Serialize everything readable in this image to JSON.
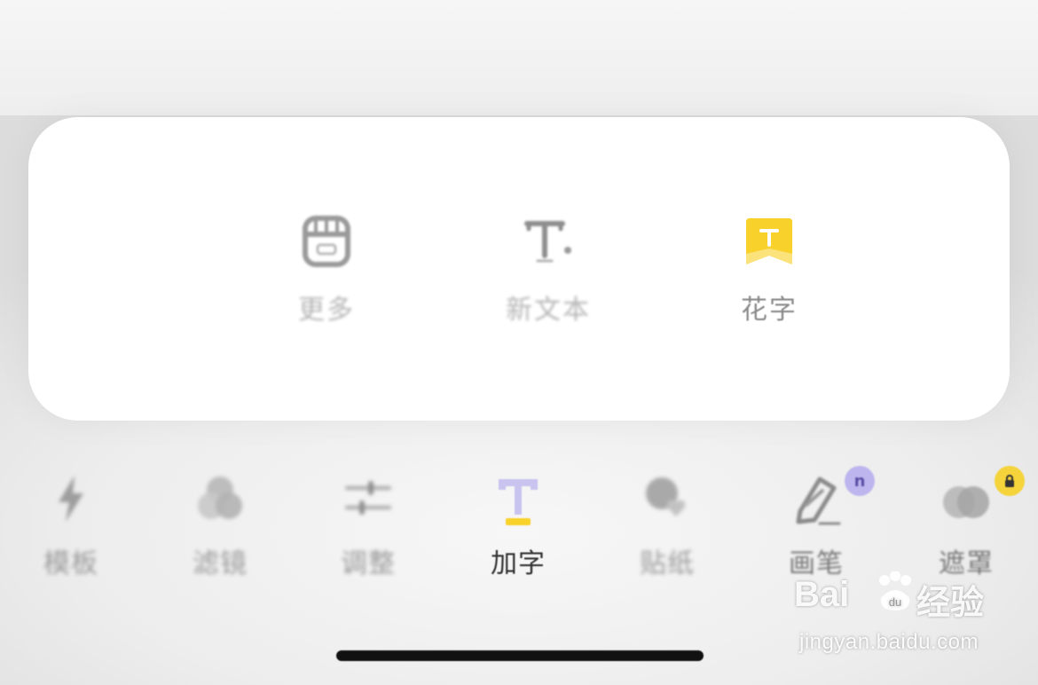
{
  "popup": {
    "options": [
      {
        "label": "更多",
        "icon": "store-icon"
      },
      {
        "label": "新文本",
        "icon": "text-add-icon"
      },
      {
        "label": "花字",
        "icon": "fancy-text-icon",
        "active": true
      }
    ]
  },
  "toolbar": {
    "items": [
      {
        "label": "模板",
        "icon": "lightning-icon"
      },
      {
        "label": "滤镜",
        "icon": "filter-circles-icon"
      },
      {
        "label": "调整",
        "icon": "sliders-icon"
      },
      {
        "label": "加字",
        "icon": "text-icon",
        "active": true
      },
      {
        "label": "贴纸",
        "icon": "sticker-icon"
      },
      {
        "label": "画笔",
        "icon": "brush-icon",
        "badge": "n"
      },
      {
        "label": "遮罩",
        "icon": "mask-icon",
        "badge_icon": "lock-icon"
      }
    ]
  },
  "watermark": {
    "logo_text": "Bai",
    "logo_suffix": "du",
    "cn_text": "经验",
    "url": "jingyan.baidu.com"
  },
  "colors": {
    "accent_yellow": "#f9d12b",
    "accent_purple": "#c9c3ef",
    "badge_purple": "#bdb6ee",
    "badge_yellow": "#f5d33a"
  }
}
